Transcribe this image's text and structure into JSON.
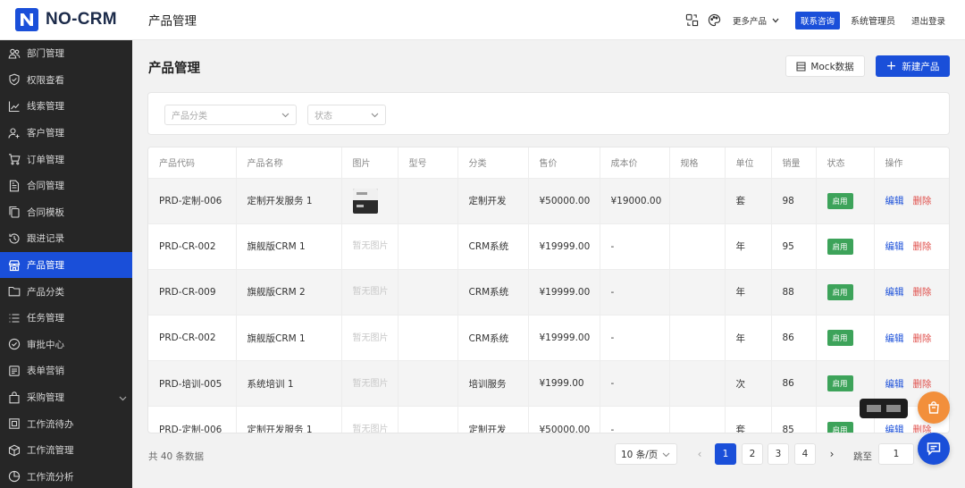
{
  "brand": {
    "name": "NO-CRM"
  },
  "header": {
    "page_title": "产品管理",
    "more_products": "更多产品",
    "contact": "联系咨询",
    "user": "系统管理员",
    "logout": "退出登录",
    "icons": [
      "translate-icon",
      "palette-icon",
      "chevron-down-icon"
    ]
  },
  "sidebar": {
    "items": [
      {
        "label": "部门管理",
        "icon": "users-icon",
        "active": false
      },
      {
        "label": "权限查看",
        "icon": "shield-check-icon",
        "active": false
      },
      {
        "label": "线索管理",
        "icon": "trend-line-icon",
        "active": false
      },
      {
        "label": "客户管理",
        "icon": "user-add-icon",
        "active": false
      },
      {
        "label": "订单管理",
        "icon": "cart-icon",
        "active": false
      },
      {
        "label": "合同管理",
        "icon": "contract-icon",
        "active": false
      },
      {
        "label": "合同模板",
        "icon": "copy-icon",
        "active": false
      },
      {
        "label": "跟进记录",
        "icon": "history-icon",
        "active": false
      },
      {
        "label": "产品管理",
        "icon": "shop-icon",
        "active": true
      },
      {
        "label": "产品分类",
        "icon": "folder-icon",
        "active": false
      },
      {
        "label": "任务管理",
        "icon": "list-icon",
        "active": false
      },
      {
        "label": "审批中心",
        "icon": "check-circle-icon",
        "active": false
      },
      {
        "label": "表单营销",
        "icon": "form-icon",
        "active": false
      },
      {
        "label": "采购管理",
        "icon": "bag-icon",
        "active": false,
        "expandable": true
      },
      {
        "label": "工作流待办",
        "icon": "todo-icon",
        "active": false
      },
      {
        "label": "工作流管理",
        "icon": "cube-icon",
        "active": false
      },
      {
        "label": "工作流分析",
        "icon": "pie-icon",
        "active": false
      }
    ]
  },
  "main": {
    "title": "产品管理",
    "mock_button": "Mock数据",
    "new_button": "新建产品",
    "filters": {
      "category_placeholder": "产品分类",
      "status_placeholder": "状态"
    },
    "table": {
      "columns": [
        "产品代码",
        "产品名称",
        "图片",
        "型号",
        "分类",
        "售价",
        "成本价",
        "规格",
        "单位",
        "销量",
        "状态",
        "操作"
      ],
      "no_image_text": "暂无图片",
      "edit_label": "编辑",
      "delete_label": "删除",
      "rows": [
        {
          "code": "PRD-定制-006",
          "name": "定制开发服务 1",
          "image": "thumbnail",
          "model": "",
          "category": "定制开发",
          "price": "¥50000.00",
          "cost": "¥19000.00",
          "spec": "",
          "unit": "套",
          "sales": "98",
          "status": "启用"
        },
        {
          "code": "PRD-CR-002",
          "name": "旗舰版CRM 1",
          "image": "none",
          "model": "",
          "category": "CRM系统",
          "price": "¥19999.00",
          "cost": "-",
          "spec": "",
          "unit": "年",
          "sales": "95",
          "status": "启用"
        },
        {
          "code": "PRD-CR-009",
          "name": "旗舰版CRM 2",
          "image": "none",
          "model": "",
          "category": "CRM系统",
          "price": "¥19999.00",
          "cost": "-",
          "spec": "",
          "unit": "年",
          "sales": "88",
          "status": "启用"
        },
        {
          "code": "PRD-CR-002",
          "name": "旗舰版CRM 1",
          "image": "none",
          "model": "",
          "category": "CRM系统",
          "price": "¥19999.00",
          "cost": "-",
          "spec": "",
          "unit": "年",
          "sales": "86",
          "status": "启用"
        },
        {
          "code": "PRD-培训-005",
          "name": "系统培训 1",
          "image": "none",
          "model": "",
          "category": "培训服务",
          "price": "¥1999.00",
          "cost": "-",
          "spec": "",
          "unit": "次",
          "sales": "86",
          "status": "启用"
        },
        {
          "code": "PRD-定制-006",
          "name": "定制开发服务 1",
          "image": "none",
          "model": "",
          "category": "定制开发",
          "price": "¥50000.00",
          "cost": "-",
          "spec": "",
          "unit": "套",
          "sales": "85",
          "status": "启用"
        }
      ]
    },
    "footer": {
      "total": "共 40 条数据",
      "page_size": "10 条/页",
      "pages": [
        "1",
        "2",
        "3",
        "4"
      ],
      "current_page": "1",
      "jump_label": "跳至",
      "jump_value": "1"
    }
  },
  "colors": {
    "accent": "#1a4fd9",
    "success": "#3da35a",
    "danger": "#e0504c",
    "sidebar_bg": "#262626",
    "cart_fab": "#f28f3b"
  }
}
